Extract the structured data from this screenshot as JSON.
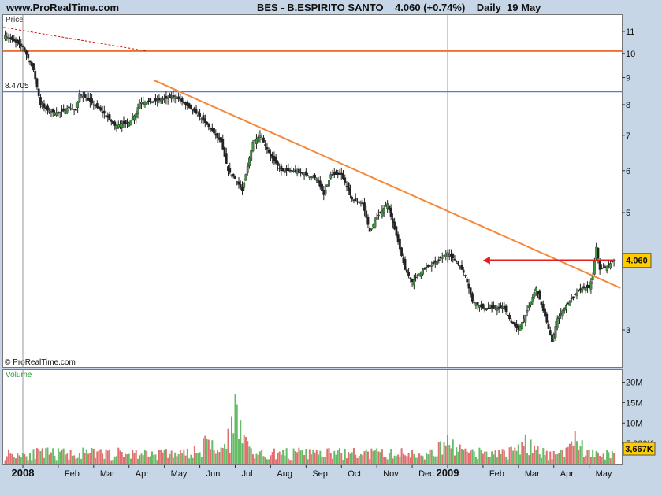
{
  "header": {
    "site": "www.ProRealTime.com",
    "info": "BES - B.ESPIRITO SANTO    4.060 (+0.74%)    Daily  19 May"
  },
  "panels": {
    "price_label": "Price",
    "volume_label": "Volume",
    "watermark": "© ProRealTime.com"
  },
  "chart_data": {
    "type": "candlestick",
    "title": "BES - B.ESPIRITO SANTO",
    "last_price": "4.060",
    "change": "+0.74%",
    "period": "Daily",
    "date": "19 May",
    "y_scale": "log",
    "ylim": [
      2.75,
      12
    ],
    "y_ticks": [
      "11",
      "10",
      "9",
      "8",
      "7",
      "6",
      "5",
      "4",
      "3"
    ],
    "y_tick_values": [
      11,
      10,
      9,
      8,
      7,
      6,
      5,
      4,
      3
    ],
    "x_ticks": [
      "2008",
      "Feb",
      "Mar",
      "Apr",
      "May",
      "Jun",
      "Jul",
      "Aug",
      "Sep",
      "Oct",
      "Nov",
      "Dec",
      "2009",
      "Feb",
      "Mar",
      "Apr",
      "May"
    ],
    "x_tick_months": [
      0,
      1,
      2,
      3,
      4,
      5,
      6,
      7,
      8,
      9,
      10,
      11,
      12,
      13,
      14,
      15,
      16
    ],
    "x_bold": [
      "2008",
      "2009"
    ],
    "month_range": [
      -0.55,
      16.88
    ],
    "price_marker": "4.060",
    "level_label": "8.4705",
    "level_value": 8.4705,
    "resistance_value": 10.1,
    "price_path": [
      [
        -0.5,
        10.8
      ],
      [
        -0.2,
        10.5
      ],
      [
        0.0,
        10.3
      ],
      [
        0.3,
        9.3
      ],
      [
        0.5,
        8.0
      ],
      [
        0.7,
        7.8
      ],
      [
        1.0,
        7.7
      ],
      [
        1.3,
        7.9
      ],
      [
        1.5,
        7.8
      ],
      [
        1.6,
        8.4
      ],
      [
        2.0,
        8.0
      ],
      [
        2.3,
        7.7
      ],
      [
        2.6,
        7.3
      ],
      [
        3.0,
        7.4
      ],
      [
        3.2,
        7.7
      ],
      [
        3.3,
        8.1
      ],
      [
        3.6,
        8.1
      ],
      [
        4.0,
        8.2
      ],
      [
        4.3,
        8.3
      ],
      [
        4.6,
        8.0
      ],
      [
        5.0,
        7.6
      ],
      [
        5.3,
        7.2
      ],
      [
        5.6,
        6.8
      ],
      [
        5.8,
        6.0
      ],
      [
        6.0,
        5.8
      ],
      [
        6.2,
        5.5
      ],
      [
        6.5,
        6.8
      ],
      [
        6.7,
        7.0
      ],
      [
        7.0,
        6.4
      ],
      [
        7.3,
        6.0
      ],
      [
        7.6,
        6.0
      ],
      [
        8.0,
        5.9
      ],
      [
        8.3,
        5.8
      ],
      [
        8.5,
        5.4
      ],
      [
        8.7,
        5.9
      ],
      [
        9.0,
        5.9
      ],
      [
        9.3,
        5.3
      ],
      [
        9.6,
        5.2
      ],
      [
        9.8,
        4.6
      ],
      [
        10.0,
        4.9
      ],
      [
        10.3,
        5.2
      ],
      [
        10.6,
        4.4
      ],
      [
        10.8,
        3.9
      ],
      [
        11.0,
        3.7
      ],
      [
        11.3,
        3.9
      ],
      [
        11.6,
        4.0
      ],
      [
        12.0,
        4.2
      ],
      [
        12.3,
        4.0
      ],
      [
        12.5,
        3.8
      ],
      [
        12.7,
        3.4
      ],
      [
        13.0,
        3.3
      ],
      [
        13.3,
        3.3
      ],
      [
        13.6,
        3.3
      ],
      [
        13.8,
        3.1
      ],
      [
        14.0,
        3.0
      ],
      [
        14.2,
        3.2
      ],
      [
        14.5,
        3.6
      ],
      [
        14.8,
        3.1
      ],
      [
        14.95,
        2.85
      ],
      [
        15.1,
        3.15
      ],
      [
        15.3,
        3.3
      ],
      [
        15.6,
        3.5
      ],
      [
        15.8,
        3.6
      ],
      [
        16.0,
        3.6
      ],
      [
        16.1,
        3.8
      ],
      [
        16.2,
        4.3
      ],
      [
        16.3,
        3.9
      ],
      [
        16.5,
        3.95
      ],
      [
        16.7,
        4.06
      ]
    ],
    "downtrend": {
      "start": [
        3.7,
        8.9
      ],
      "end": [
        16.88,
        3.6
      ]
    },
    "dashed_trend": {
      "start": [
        -0.55,
        11.2
      ],
      "end": [
        3.5,
        10.1
      ]
    },
    "support_arrow": {
      "from": [
        16.7,
        4.06
      ],
      "to": [
        13.0,
        4.06
      ]
    },
    "volume": {
      "label": "Volume",
      "ylim": [
        0,
        23000000
      ],
      "y_ticks": [
        "20M",
        "15M",
        "10M",
        "5,000K"
      ],
      "y_tick_values": [
        20000000,
        15000000,
        10000000,
        5000000
      ],
      "last_value": "3,667K",
      "last_numeric": 3667000,
      "baseline": 2200000,
      "spikes": [
        {
          "month": 6.0,
          "value": 17000000
        },
        {
          "month": 5.2,
          "value": 6000000
        },
        {
          "month": 12.0,
          "value": 7000000
        },
        {
          "month": 14.2,
          "value": 7200000
        },
        {
          "month": 15.6,
          "value": 8000000
        }
      ]
    }
  },
  "colors": {
    "background": "#C6D6E6",
    "panel": "#FFFFFF",
    "resistance": "#F07030",
    "level": "#4D7FE8",
    "trendline": "#F5883A",
    "dashed": "#CC1111",
    "arrow": "#E02020",
    "marker_bg": "#FFCC00",
    "volume_bar": "#E07070",
    "candle_up": "#3C9A3C",
    "candle_down": "#222222"
  }
}
